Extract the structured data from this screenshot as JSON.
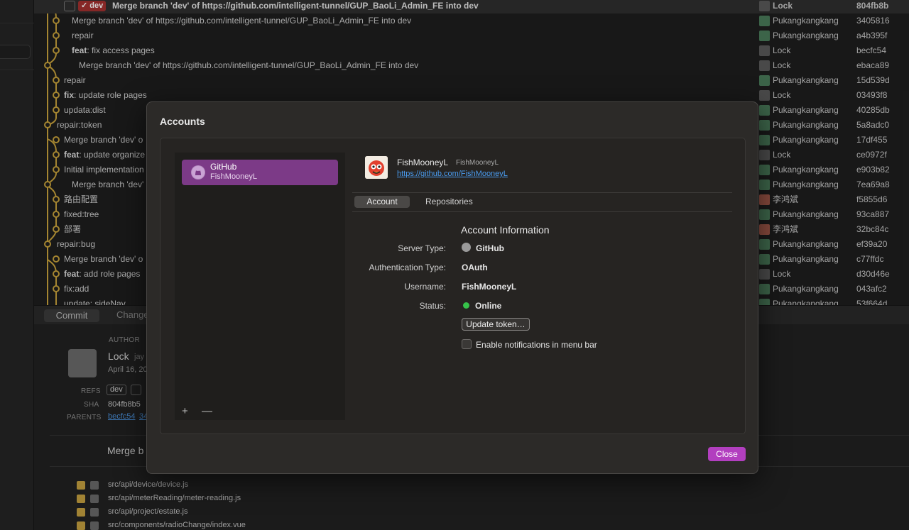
{
  "commits": [
    {
      "message": "Merge branch 'dev' of https://github.com/intelligent-tunnel/GUP_BaoLi_Admin_FE into dev",
      "prefix": "",
      "author": "Lock",
      "sha": "804fb8b",
      "selected": true,
      "ref": "dev"
    },
    {
      "message": "Merge branch 'dev' of https://github.com/intelligent-tunnel/GUP_BaoLi_Admin_FE into dev",
      "prefix": "",
      "author": "Pukangkangkang",
      "sha": "3405816"
    },
    {
      "message": "repair",
      "prefix": "",
      "author": "Pukangkangkang",
      "sha": "a4b395f"
    },
    {
      "message": ": fix access pages",
      "prefix": "feat",
      "author": "Lock",
      "sha": "becfc54"
    },
    {
      "message": "Merge branch 'dev' of https://github.com/intelligent-tunnel/GUP_BaoLi_Admin_FE into dev",
      "prefix": "",
      "author": "Lock",
      "sha": "ebaca89"
    },
    {
      "message": "repair",
      "prefix": "",
      "author": "Pukangkangkang",
      "sha": "15d539d"
    },
    {
      "message": ": update role pages",
      "prefix": "fix",
      "author": "Lock",
      "sha": "03493f8"
    },
    {
      "message": "updata:dist",
      "prefix": "",
      "author": "Pukangkangkang",
      "sha": "40285db"
    },
    {
      "message": "repair:token",
      "prefix": "",
      "author": "Pukangkangkang",
      "sha": "5a8adc0"
    },
    {
      "message": "Merge branch 'dev' o",
      "prefix": "",
      "author": "Pukangkangkang",
      "sha": "17df455"
    },
    {
      "message": ": update organize",
      "prefix": "feat",
      "author": "Lock",
      "sha": "ce0972f"
    },
    {
      "message": "Initial implementation",
      "prefix": "",
      "author": "Pukangkangkang",
      "sha": "e903b82"
    },
    {
      "message": "Merge branch 'dev'",
      "prefix": "",
      "author": "Pukangkangkang",
      "sha": "7ea69a8"
    },
    {
      "message": "路由配置",
      "prefix": "",
      "author": "李鸿斌",
      "sha": "f5855d6"
    },
    {
      "message": "fixed:tree",
      "prefix": "",
      "author": "Pukangkangkang",
      "sha": "93ca887"
    },
    {
      "message": "部署",
      "prefix": "",
      "author": "李鸿斌",
      "sha": "32bc84c"
    },
    {
      "message": "repair:bug",
      "prefix": "",
      "author": "Pukangkangkang",
      "sha": "ef39a20"
    },
    {
      "message": "Merge branch 'dev' o",
      "prefix": "",
      "author": "Pukangkangkang",
      "sha": "c77ffdc"
    },
    {
      "message": ": add role pages",
      "prefix": "feat",
      "author": "Lock",
      "sha": "d30d46e"
    },
    {
      "message": "fix:add",
      "prefix": "",
      "author": "Pukangkangkang",
      "sha": "043afc2"
    },
    {
      "message": "update: sideNav",
      "prefix": "",
      "author": "Pukangkangkang",
      "sha": "53f664d"
    }
  ],
  "details": {
    "tab_commit": "Commit",
    "tab_changes": "Changes",
    "author_label": "AUTHOR",
    "author_name": "Lock",
    "author_email": "jay",
    "date": "April 16, 20",
    "refs_label": "REFS",
    "ref_dev": "dev",
    "sha_label": "SHA",
    "sha_value": "804fb8b5",
    "parents_label": "PARENTS",
    "parents_value": "becfc54",
    "parents_value2": "34",
    "summary": "Merge b",
    "files": [
      {
        "path": "src/api/device/device.js",
        "badge": "M"
      },
      {
        "path": "src/api/meterReading/meter-reading.js",
        "badge": "M"
      },
      {
        "path": "src/api/project/estate.js",
        "badge": "M"
      },
      {
        "path": "src/components/radioChange/index.vue",
        "badge": "M"
      }
    ]
  },
  "dialog": {
    "title": "Accounts",
    "account_item": {
      "service": "GitHub",
      "login": "FishMooneyL"
    },
    "add_symbol": "+",
    "remove_symbol": "—",
    "profile": {
      "name": "FishMooneyL",
      "login": "FishMooneyL",
      "url": "https://github.com/FishMooneyL"
    },
    "tabs": {
      "account": "Account",
      "repositories": "Repositories"
    },
    "info_title": "Account Information",
    "labels": {
      "server_type": "Server Type:",
      "auth_type": "Authentication Type:",
      "username": "Username:",
      "status": "Status:"
    },
    "values": {
      "server_type": "GitHub",
      "auth_type": "OAuth",
      "username": "FishMooneyL",
      "status": "Online"
    },
    "update_token": "Update token…",
    "notifications_label": "Enable notifications in menu bar",
    "close": "Close"
  },
  "colors": {
    "accent": "#b23fbf",
    "selection": "#7c3a87",
    "link": "#4a9cf0",
    "online": "#36c24a",
    "graph": "#c9a33c"
  }
}
